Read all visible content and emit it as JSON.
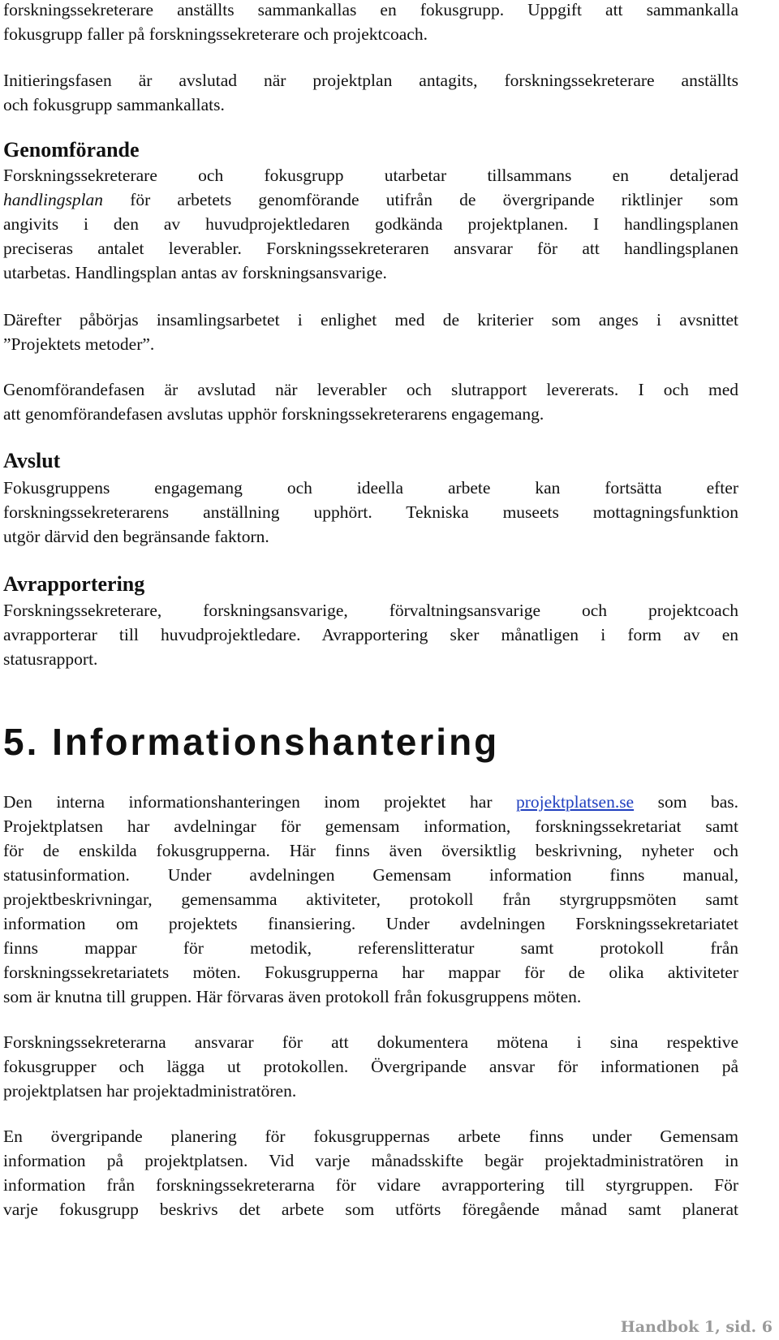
{
  "document": {
    "intro": {
      "p1": [
        "forskningssekreterare anställts sammankallas en fokusgrupp. Uppgift att sammankalla",
        "fokusgrupp faller på forskningssekreterare och projektcoach."
      ],
      "p2": [
        "Initieringsfasen är avslutad när projektplan antagits, forskningssekreterare anställts",
        "och fokusgrupp sammankallats."
      ]
    },
    "genomforande": {
      "heading": "Genomförande",
      "p1_line1": "Forskningssekreterare och fokusgrupp utarbetar tillsammans en detaljerad",
      "p1_line2_italic": "handlingsplan",
      "p1_line2_rest": " för arbetets genomförande utifrån de övergripande riktlinjer som",
      "p1_rest": [
        "angivits i den av huvudprojektledaren godkända projektplanen. I handlingsplanen",
        "preciseras antalet leverabler. Forskningssekreteraren ansvarar för att handlingsplanen",
        "utarbetas. Handlingsplan antas av forskningsansvarige."
      ],
      "p2": [
        "Därefter påbörjas insamlingsarbetet i enlighet med de kriterier som anges i avsnittet",
        "”Projektets metoder”."
      ],
      "p3": [
        "Genomförandefasen är avslutad när leverabler och slutrapport levererats. I och med",
        "att genomförandefasen avslutas upphör forskningssekreterarens engagemang."
      ]
    },
    "avslut": {
      "heading": "Avslut",
      "p1": [
        "Fokusgruppens engagemang och ideella arbete kan fortsätta efter",
        "forskningssekreterarens anställning upphört. Tekniska museets mottagningsfunktion",
        "utgör därvid den begränsande faktorn."
      ]
    },
    "avrapportering": {
      "heading": "Avrapportering",
      "p1": [
        "Forskningssekreterare, forskningsansvarige, förvaltningsansvarige och projektcoach",
        "avrapporterar till huvudprojektledare. Avrapportering sker månatligen i form av en",
        "statusrapport."
      ]
    },
    "section5": {
      "heading": "5. Informationshantering",
      "p1_line1_before": "Den interna informationshanteringen inom projektet har ",
      "p1_link": "projektplatsen.se",
      "p1_line1_after": " som bas.",
      "p1_rest": [
        "Projektplatsen har avdelningar för gemensam information, forskningssekretariat samt",
        "för de enskilda fokusgrupperna. Här finns även översiktlig beskrivning, nyheter och",
        "statusinformation. Under avdelningen Gemensam information finns manual,",
        "projektbeskrivningar, gemensamma aktiviteter, protokoll från styrgruppsmöten samt",
        "information om projektets finansiering. Under avdelningen Forskningssekretariatet",
        "finns mappar för metodik, referenslitteratur samt protokoll från",
        "forskningssekretariatets möten. Fokusgrupperna har mappar för de olika aktiviteter",
        "som är knutna till gruppen. Här förvaras även protokoll från fokusgruppens möten."
      ],
      "p2": [
        "Forskningssekreterarna ansvarar för att dokumentera mötena i sina respektive",
        "fokusgrupper och lägga ut protokollen. Övergripande ansvar för informationen på",
        "projektplatsen har projektadministratören."
      ],
      "p3": [
        "En övergripande planering för fokusgruppernas arbete finns under Gemensam",
        "information på projektplatsen. Vid varje månadsskifte begär projektadministratören in",
        "information från forskningssekreterarna för vidare avrapportering till styrgruppen. För",
        "varje fokusgrupp beskrivs det arbete som utförts föregående månad samt planerat"
      ]
    },
    "footer": "Handbok 1, sid. 6"
  }
}
